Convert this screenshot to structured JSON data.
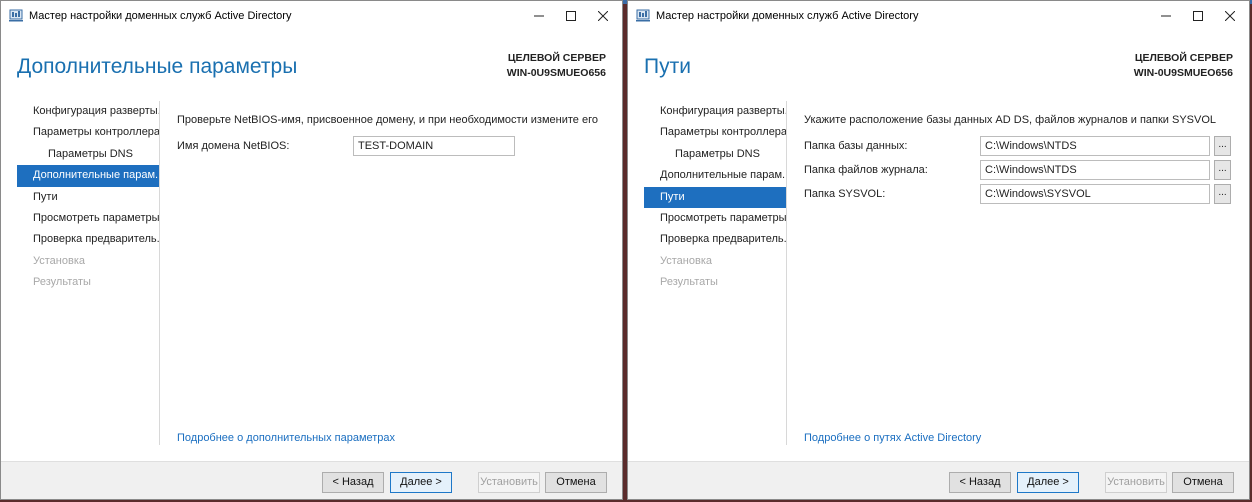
{
  "windows": [
    {
      "title": "Мастер настройки доменных служб Active Directory",
      "heading": "Дополнительные параметры",
      "target_label": "ЦЕЛЕВОЙ СЕРВЕР",
      "target_server": "WIN-0U9SMUEO656",
      "nav": [
        "Конфигурация разверты...",
        "Параметры контроллера...",
        "Параметры DNS",
        "Дополнительные парам...",
        "Пути",
        "Просмотреть параметры",
        "Проверка предваритель...",
        "Установка",
        "Результаты"
      ],
      "instruction": "Проверьте NetBIOS-имя, присвоенное домену, и при необходимости измените его",
      "netbios_label": "Имя домена NetBIOS:",
      "netbios_value": "TEST-DOMAIN",
      "more_link": "Подробнее о дополнительных параметрах",
      "buttons": {
        "back": "< Назад",
        "next": "Далее >",
        "install": "Установить",
        "cancel": "Отмена"
      }
    },
    {
      "title": "Мастер настройки доменных служб Active Directory",
      "heading": "Пути",
      "target_label": "ЦЕЛЕВОЙ СЕРВЕР",
      "target_server": "WIN-0U9SMUEO656",
      "nav": [
        "Конфигурация разверты...",
        "Параметры контроллера...",
        "Параметры DNS",
        "Дополнительные парам...",
        "Пути",
        "Просмотреть параметры",
        "Проверка предваритель...",
        "Установка",
        "Результаты"
      ],
      "instruction": "Укажите расположение базы данных AD DS, файлов журналов и папки SYSVOL",
      "paths": [
        {
          "label": "Папка базы данных:",
          "value": "C:\\Windows\\NTDS"
        },
        {
          "label": "Папка файлов журнала:",
          "value": "C:\\Windows\\NTDS"
        },
        {
          "label": "Папка SYSVOL:",
          "value": "C:\\Windows\\SYSVOL"
        }
      ],
      "browse_label": "...",
      "more_link": "Подробнее о путях Active Directory",
      "buttons": {
        "back": "< Назад",
        "next": "Далее >",
        "install": "Установить",
        "cancel": "Отмена"
      }
    }
  ]
}
